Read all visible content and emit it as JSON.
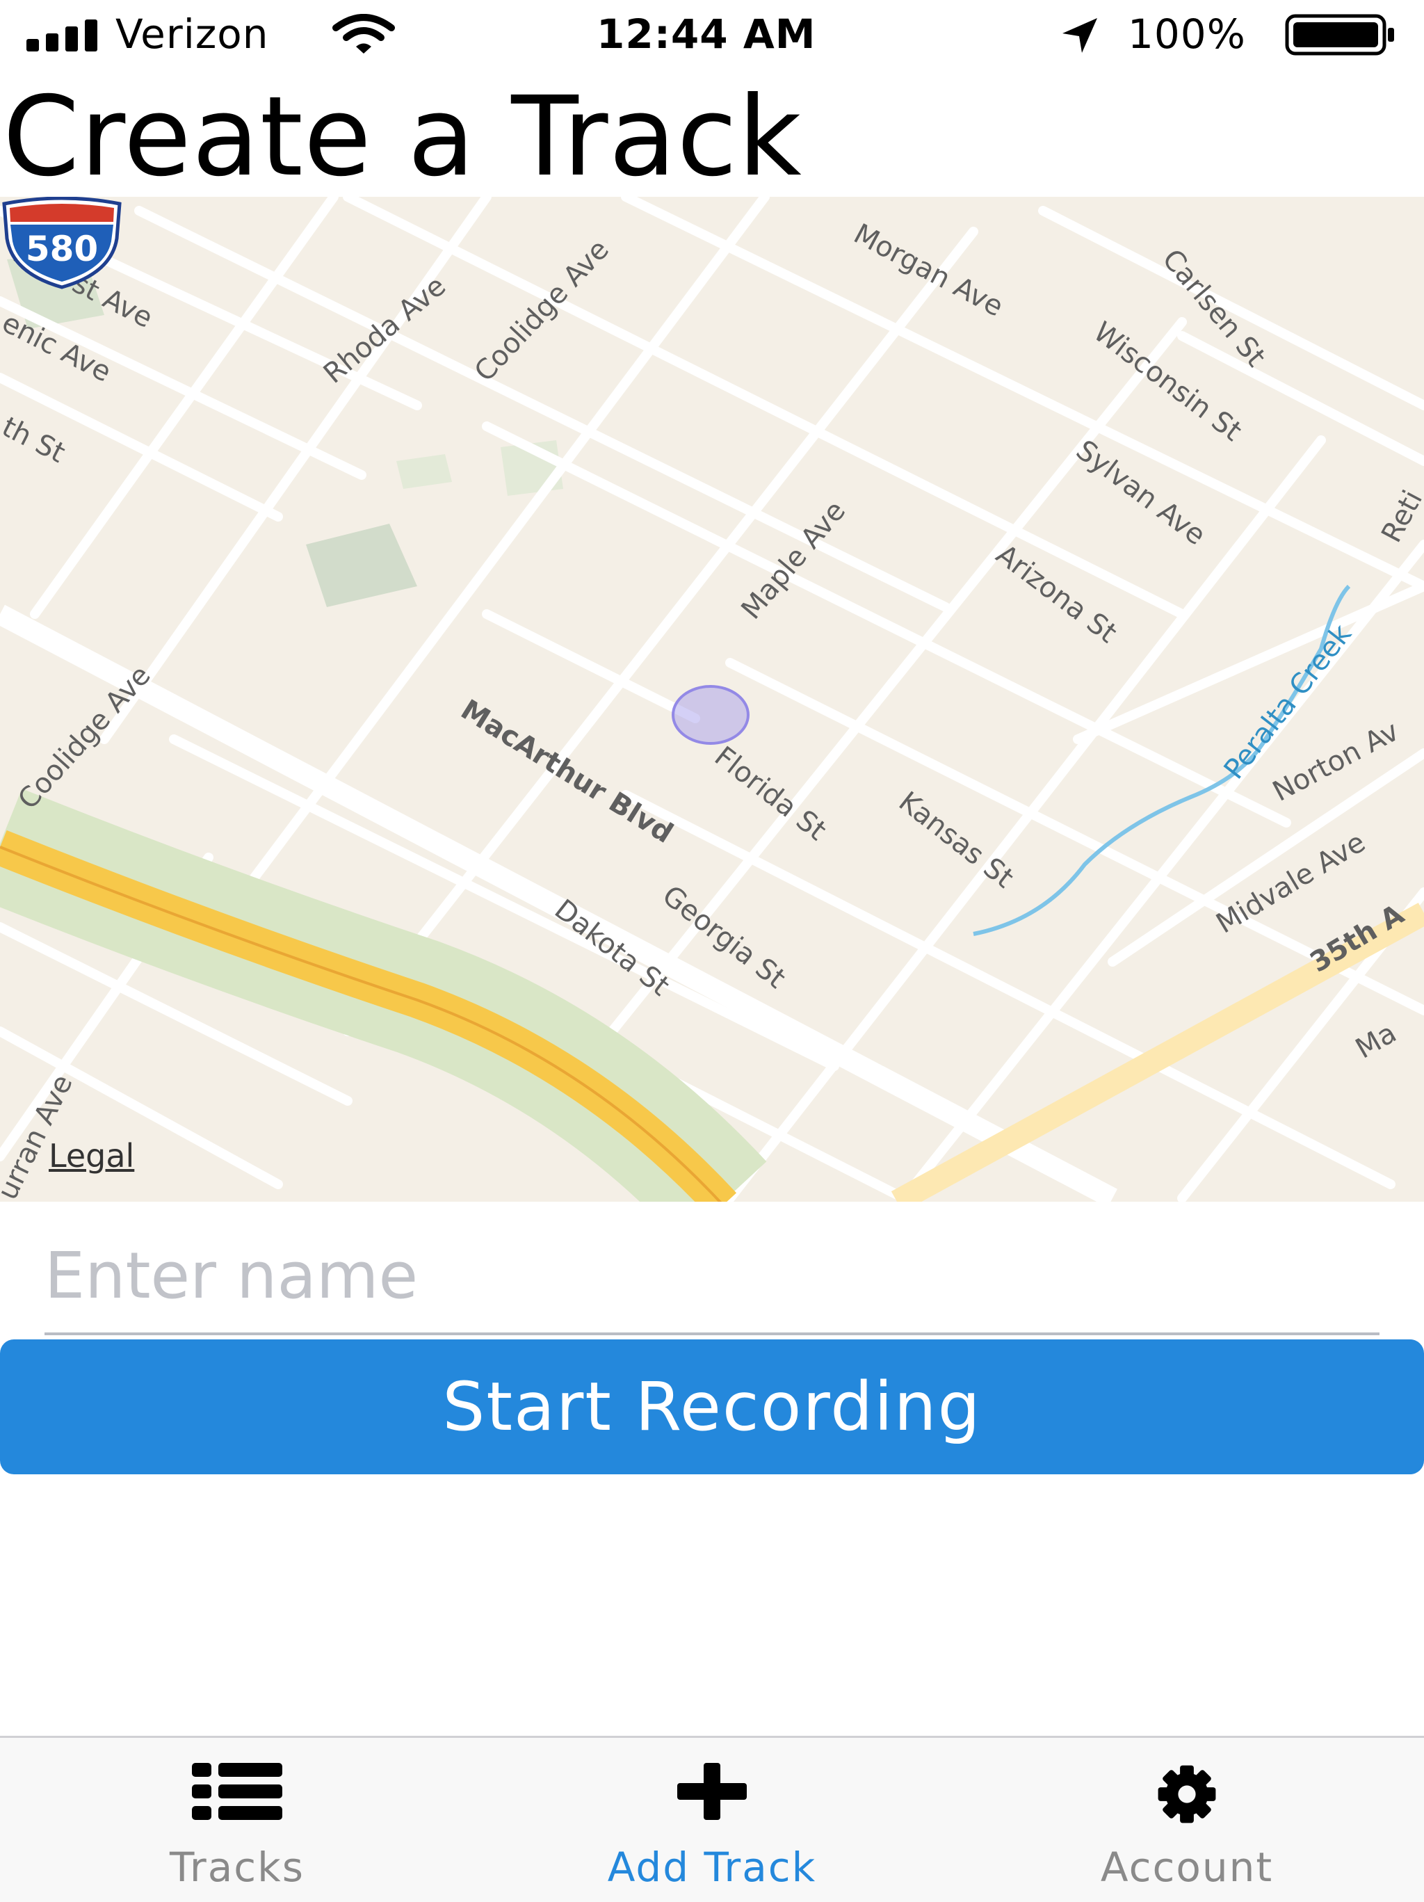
{
  "status_bar": {
    "carrier": "Verizon",
    "time": "12:44 AM",
    "battery": "100%",
    "icons": [
      "signal-icon",
      "wifi-icon",
      "location-arrow-icon",
      "battery-icon"
    ]
  },
  "page": {
    "title": "Create a Track"
  },
  "map": {
    "legal_label": "Legal",
    "highway_shield": "580",
    "streets": [
      "Hearst Ave",
      "enic Ave",
      "th St",
      "Rhoda Ave",
      "Coolidge Ave",
      "Morgan Ave",
      "Carlsen St",
      "Wisconsin St",
      "Sylvan Ave",
      "Arizona St",
      "Maple Ave",
      "MacArthur Blvd",
      "Coolidge Ave",
      "Florida St",
      "Kansas St",
      "Peralta Creek",
      "Norton Av",
      "Midvale Ave",
      "35th A",
      "Georgia St",
      "Dakota St",
      "urran Ave",
      "Ma",
      "Reti",
      "Mac"
    ]
  },
  "form": {
    "name_placeholder": "Enter name",
    "name_value": ""
  },
  "actions": {
    "start_recording_label": "Start Recording"
  },
  "tab_bar": {
    "tabs": [
      {
        "label": "Tracks",
        "icon": "list-icon",
        "active": false
      },
      {
        "label": "Add Track",
        "icon": "plus-icon",
        "active": true
      },
      {
        "label": "Account",
        "icon": "gear-icon",
        "active": false
      }
    ]
  },
  "colors": {
    "accent": "#2488dc",
    "tab_inactive": "#8a8a8a",
    "map_background": "#f4efe6",
    "highway": "#f7c84a",
    "water": "#7ec4e8"
  }
}
